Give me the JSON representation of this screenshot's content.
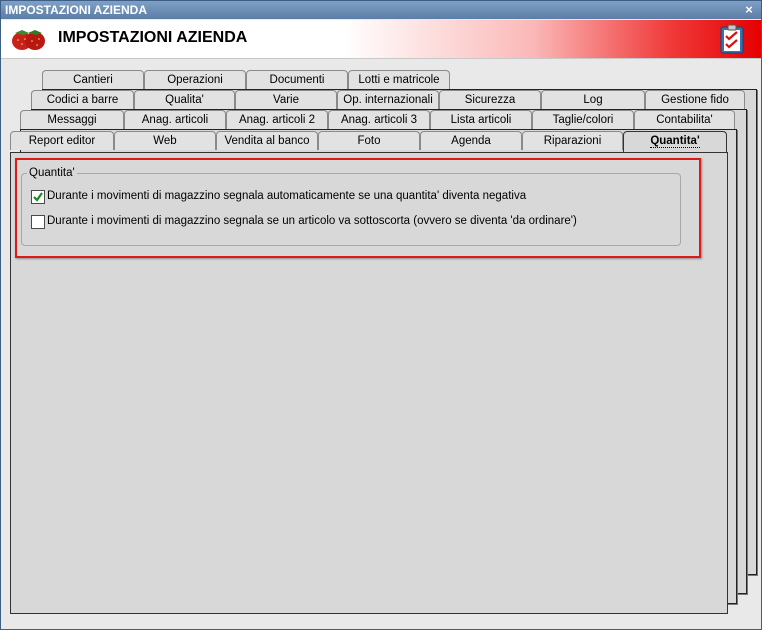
{
  "window": {
    "title": "IMPOSTAZIONI AZIENDA",
    "close_glyph": "×"
  },
  "header": {
    "title": "IMPOSTAZIONI AZIENDA",
    "logo_icon": "strawberry-icon",
    "action_icon": "clipboard-checklist-icon"
  },
  "tabs": {
    "row1": [
      "Cantieri",
      "Operazioni",
      "Documenti",
      "Lotti e matricole"
    ],
    "row2": [
      "Codici a barre",
      "Qualita'",
      "Varie",
      "Op. internazionali",
      "Sicurezza",
      "Log",
      "Gestione fido"
    ],
    "row3": [
      "Messaggi",
      "Anag. articoli",
      "Anag. articoli 2",
      "Anag. articoli 3",
      "Lista articoli",
      "Taglie/colori",
      "Contabilita'"
    ],
    "row4": [
      "Report editor",
      "Web",
      "Vendita al banco",
      "Foto",
      "Agenda",
      "Riparazioni",
      "Quantita'"
    ],
    "active": "Quantita'"
  },
  "group": {
    "title": "Quantita'",
    "options": [
      {
        "label": "Durante i movimenti di magazzino segnala automaticamente se una quantita' diventa negativa",
        "checked": true
      },
      {
        "label": "Durante i movimenti di magazzino segnala se un articolo va sottoscorta (ovvero se diventa 'da ordinare')",
        "checked": false
      }
    ]
  },
  "colors": {
    "highlight_border": "#dc1a1a",
    "title_bar": "#6a8db5",
    "header_gradient_end": "#e50000"
  }
}
